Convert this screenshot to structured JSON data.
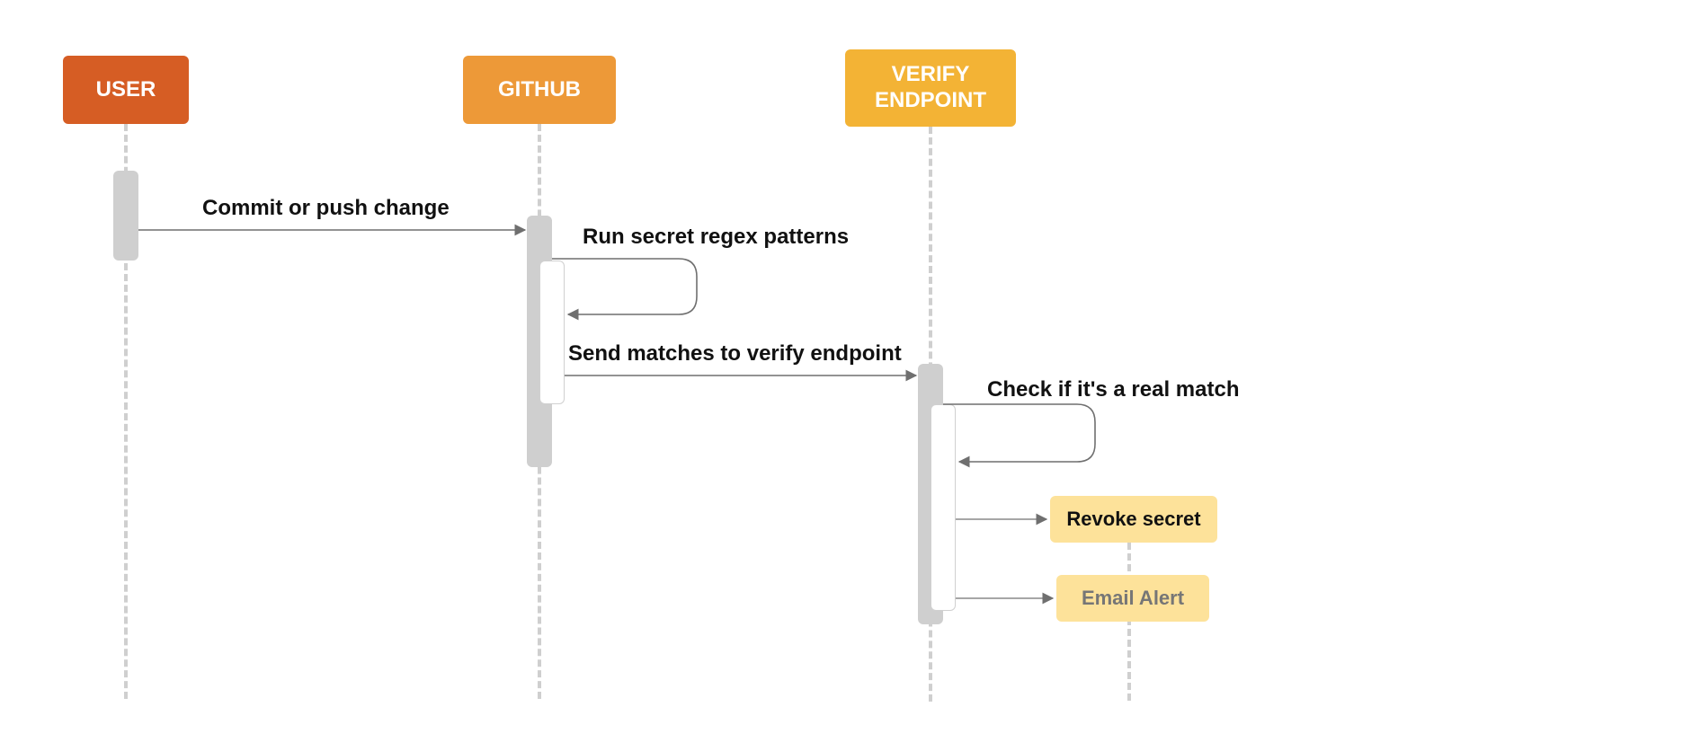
{
  "participants": {
    "user": {
      "label": "USER",
      "color": "#d65d24"
    },
    "github": {
      "label": "GITHUB",
      "color": "#ed9938"
    },
    "verify": {
      "label": "VERIFY ENDPOINT",
      "color": "#f3b335"
    }
  },
  "messages": {
    "commit": "Commit or push change",
    "regex": "Run secret regex patterns",
    "send_matches": "Send matches to verify endpoint",
    "check_real": "Check if it's a real match"
  },
  "actions": {
    "revoke": {
      "label": "Revoke secret",
      "bg": "#fde29a",
      "fg": "#111111"
    },
    "email": {
      "label": "Email Alert",
      "bg": "#fde29a",
      "fg": "#767676"
    }
  }
}
